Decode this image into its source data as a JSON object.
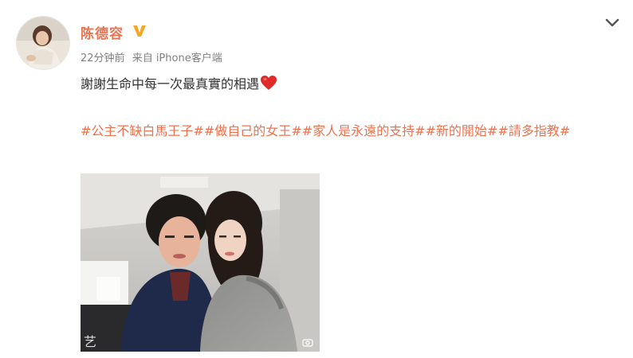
{
  "post": {
    "author": {
      "name": "陈德容",
      "verified_icon": "verified-v-icon",
      "verified_color": "#f5a623"
    },
    "time": "22分钟前",
    "source": "来自 iPhone客户端",
    "text": "謝謝生命中每一次最真實的相遇",
    "emoji": "heart-icon",
    "tags": [
      "#公主不缺白馬王子#",
      "#做自己的女王#",
      "#家人是永遠的支持#",
      "#新的開始#",
      "#請多指教#"
    ],
    "image": {
      "watermark": "艺"
    }
  },
  "colors": {
    "accent": "#eb7350",
    "text": "#333333",
    "meta": "#808080"
  }
}
